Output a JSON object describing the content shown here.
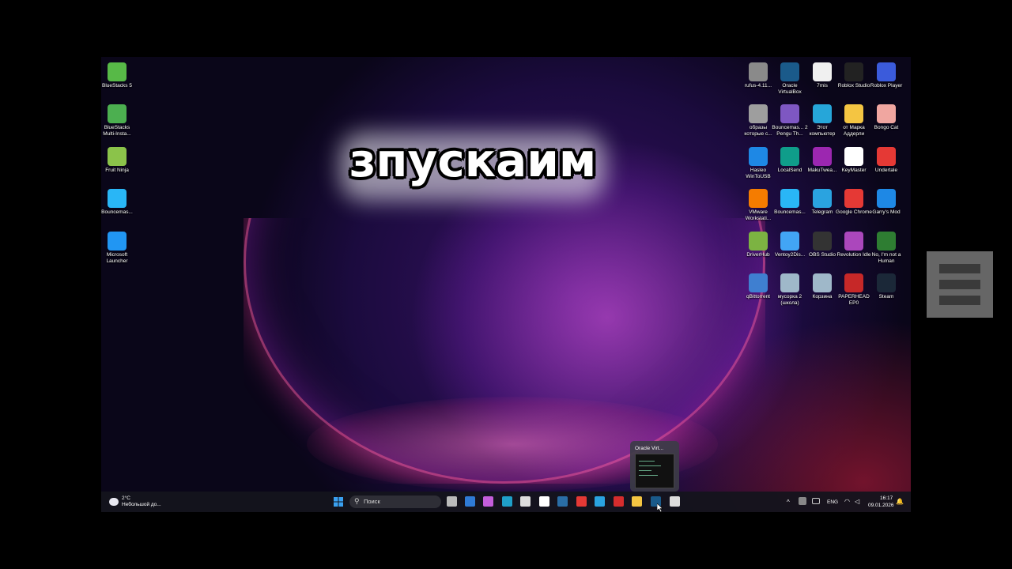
{
  "overlay_caption": "зпускаим",
  "desktop_left_icons": [
    {
      "label": "BlueStacks 5",
      "icon": "bluestacks-icon",
      "color": "#57b947"
    },
    {
      "label": "BlueStacks Multi-Insta...",
      "icon": "bluestacks-multi-icon",
      "color": "#4caf50"
    },
    {
      "label": "Fruit Ninja",
      "icon": "fruit-ninja-icon",
      "color": "#8bc34a"
    },
    {
      "label": "Bouncemas...",
      "icon": "bouncemasters-icon",
      "color": "#29b6f6"
    },
    {
      "label": "Microsoft Launcher",
      "icon": "microsoft-launcher-icon",
      "color": "#2196f3"
    }
  ],
  "desktop_right_icons": [
    {
      "label": "rufus-4.11...",
      "icon": "rufus-icon",
      "color": "#8a8a8a"
    },
    {
      "label": "Oracle VirtualBox",
      "icon": "virtualbox-icon",
      "color": "#1a5a8a"
    },
    {
      "label": "7mis",
      "icon": "chrome-shortcut-icon",
      "color": "#f0f0f0"
    },
    {
      "label": "Roblox Studio",
      "icon": "roblox-studio-icon",
      "color": "#222"
    },
    {
      "label": "Roblox Player",
      "icon": "roblox-player-icon",
      "color": "#3b5bdb"
    },
    {
      "label": "образы которые с...",
      "icon": "gear-folder-icon",
      "color": "#9e9e9e"
    },
    {
      "label": "Bouncemas... 2 Pengu Th...",
      "icon": "bouncemasters2-icon",
      "color": "#7e57c2"
    },
    {
      "label": "Этот компьютер",
      "icon": "this-pc-icon",
      "color": "#26a6d9"
    },
    {
      "label": "от Марка Аддерли",
      "icon": "folder-icon",
      "color": "#f4c542"
    },
    {
      "label": "Bongo Cat",
      "icon": "bongo-cat-icon",
      "color": "#f0a6a0"
    },
    {
      "label": "Hasleo WinToUSB",
      "icon": "wintousb-icon",
      "color": "#1e88e5"
    },
    {
      "label": "LocalSend",
      "icon": "localsend-icon",
      "color": "#0f9d8a"
    },
    {
      "label": "MakuTwea...",
      "icon": "makutweaker-icon",
      "color": "#9c27b0"
    },
    {
      "label": "KeyMaster",
      "icon": "keymaster-icon",
      "color": "#fff"
    },
    {
      "label": "Undertale",
      "icon": "undertale-heart-icon",
      "color": "#e53935"
    },
    {
      "label": "VMware Workstati...",
      "icon": "vmware-icon",
      "color": "#f57c00"
    },
    {
      "label": "Bouncemas...",
      "icon": "bouncemasters-icon",
      "color": "#29b6f6"
    },
    {
      "label": "Telegram",
      "icon": "telegram-icon",
      "color": "#2aa3e0"
    },
    {
      "label": "Google Chrome",
      "icon": "chrome-icon",
      "color": "#e53935"
    },
    {
      "label": "Garry's Mod",
      "icon": "garrys-mod-icon",
      "color": "#1e88e5"
    },
    {
      "label": "DriverHub",
      "icon": "driverhub-icon",
      "color": "#7cb342"
    },
    {
      "label": "Ventoy2Dis...",
      "icon": "ventoy-icon",
      "color": "#42a5f5"
    },
    {
      "label": "OBS Studio",
      "icon": "obs-icon",
      "color": "#333"
    },
    {
      "label": "Revolution Idle",
      "icon": "revolution-idle-icon",
      "color": "#ab47bc"
    },
    {
      "label": "No, I'm not a Human",
      "icon": "not-human-icon",
      "color": "#2e7d32"
    },
    {
      "label": "qBittorrent",
      "icon": "qbittorrent-icon",
      "color": "#3f7fd0"
    },
    {
      "label": "мусорка 2 (школа)",
      "icon": "recycle-bin-icon",
      "color": "#9fb8c9"
    },
    {
      "label": "Корзина",
      "icon": "recycle-bin-icon",
      "color": "#9fb8c9"
    },
    {
      "label": "PAPERHEAD EP0",
      "icon": "paperhead-icon",
      "color": "#c62828"
    },
    {
      "label": "Steam",
      "icon": "steam-icon",
      "color": "#1b2838"
    }
  ],
  "preview": {
    "title": "Oracle Virt..."
  },
  "taskbar": {
    "weather_temp": "2°C",
    "weather_desc": "Небольшой до...",
    "search_placeholder": "Поиск",
    "language": "ENG",
    "time": "16:17",
    "date": "09.01.2026"
  },
  "taskbar_apps": [
    {
      "icon": "windows-start-icon",
      "color": "#3aa0f0"
    },
    {
      "icon": "task-view-icon",
      "color": "#bbb"
    },
    {
      "icon": "mail-icon",
      "color": "#2f7bd6"
    },
    {
      "icon": "copilot-icon",
      "color": "#c45edb"
    },
    {
      "icon": "edge-icon",
      "color": "#1fa0c9"
    },
    {
      "icon": "store-icon",
      "color": "#ddd"
    },
    {
      "icon": "roblox-icon",
      "color": "#fff"
    },
    {
      "icon": "steam-icon",
      "color": "#2a6ea6"
    },
    {
      "icon": "chrome-icon",
      "color": "#e53935"
    },
    {
      "icon": "telegram-icon",
      "color": "#2aa3e0"
    },
    {
      "icon": "wps-icon",
      "color": "#d62d2d"
    },
    {
      "icon": "file-explorer-icon",
      "color": "#f4c542"
    },
    {
      "icon": "virtualbox-icon",
      "color": "#1a5a8a"
    },
    {
      "icon": "active-app-icon",
      "color": "#ddd"
    }
  ]
}
